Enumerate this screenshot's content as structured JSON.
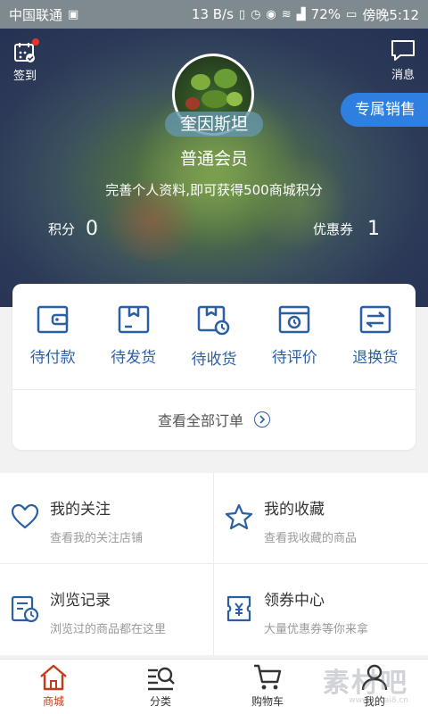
{
  "status_bar": {
    "carrier": "中国联通",
    "speed": "13 B/s",
    "battery": "72%",
    "time": "傍晚5:12"
  },
  "header": {
    "signin_label": "签到",
    "message_label": "消息",
    "sales_button": "专属销售"
  },
  "profile": {
    "name": "奎因斯坦",
    "member_level": "普通会员",
    "tip": "完善个人资料,即可获得500商城积分",
    "points_label": "积分",
    "points_value": "0",
    "coupons_label": "优惠券",
    "coupons_value": "1"
  },
  "orders": {
    "items": [
      {
        "label": "待付款",
        "icon": "wallet-icon"
      },
      {
        "label": "待发货",
        "icon": "box-icon"
      },
      {
        "label": "待收货",
        "icon": "receive-icon"
      },
      {
        "label": "待评价",
        "icon": "review-icon"
      },
      {
        "label": "退换货",
        "icon": "exchange-icon"
      }
    ],
    "view_all": "查看全部订单"
  },
  "features": [
    {
      "title": "我的关注",
      "sub": "查看我的关注店铺",
      "icon": "heart-icon"
    },
    {
      "title": "我的收藏",
      "sub": "查看我收藏的商品",
      "icon": "star-icon"
    },
    {
      "title": "浏览记录",
      "sub": "浏览过的商品都在这里",
      "icon": "history-icon"
    },
    {
      "title": "领券中心",
      "sub": "大量优惠券等你来拿",
      "icon": "coupon-icon"
    }
  ],
  "bottom_nav": [
    {
      "label": "商城",
      "icon": "home-icon",
      "active": true
    },
    {
      "label": "分类",
      "icon": "category-icon",
      "active": false
    },
    {
      "label": "购物车",
      "icon": "cart-icon",
      "active": false
    },
    {
      "label": "我的",
      "icon": "user-icon",
      "active": false
    }
  ],
  "watermark": {
    "text": "素材吧",
    "url": "www.sucai8.cn"
  },
  "colors": {
    "accent": "#2a5fa6",
    "sales_button": "#2f7fe0",
    "active_nav": "#c43b1c",
    "badge": "#e8322b"
  }
}
